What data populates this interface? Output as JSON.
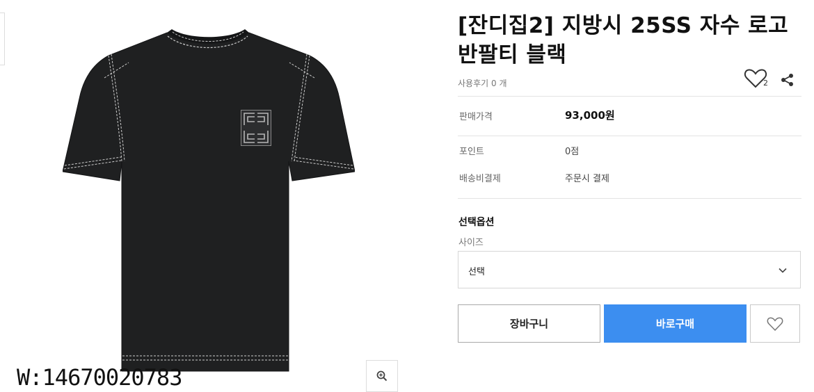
{
  "product": {
    "title": "[잔디집2] 지방시 25SS 자수 로고 반팔티 블랙",
    "review_label": "사용후기",
    "review_count": "0",
    "review_unit": "개",
    "wish_count": "2"
  },
  "details": {
    "price_label": "판매가격",
    "price_value": "93,000원",
    "point_label": "포인트",
    "point_value": "0점",
    "shipping_label": "배송비결제",
    "shipping_value": "주문시 결제"
  },
  "options": {
    "title": "선택옵션",
    "size_label": "사이즈",
    "size_selected": "선택"
  },
  "buttons": {
    "cart": "장바구니",
    "buy": "바로구매"
  },
  "image": {
    "watermark": "W:14670020783"
  },
  "colors": {
    "accent": "#3c8ef0",
    "shirt": "#1f2021",
    "stitch": "#cfcfcf"
  },
  "icons": [
    "heart-icon",
    "share-icon",
    "chevron-down-icon",
    "zoom-in-icon",
    "embroidered-logo-icon"
  ]
}
